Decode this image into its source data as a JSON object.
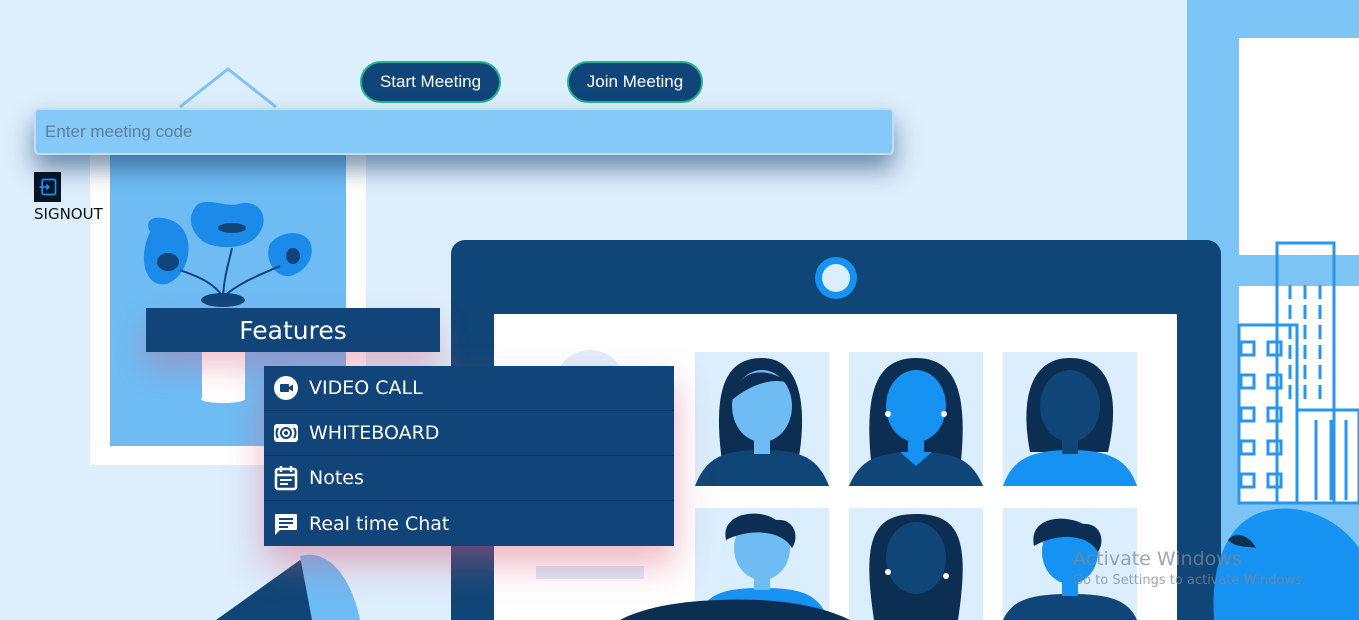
{
  "header": {
    "start_meeting_label": "Start Meeting",
    "join_meeting_label": "Join Meeting"
  },
  "meeting_code": {
    "value": "",
    "placeholder": "Enter meeting code"
  },
  "signout": {
    "label": "SIGNOUT",
    "icon": "signout-icon"
  },
  "features": {
    "title": "Features",
    "items": [
      {
        "label": "VIDEO CALL",
        "icon": "video-call-icon"
      },
      {
        "label": "WHITEBOARD",
        "icon": "whiteboard-icon"
      },
      {
        "label": "Notes",
        "icon": "notes-icon"
      },
      {
        "label": "Real time Chat",
        "icon": "chat-icon"
      }
    ]
  },
  "watermark": {
    "title": "Activate Windows",
    "subtitle": "Go to Settings to activate Windows."
  },
  "colors": {
    "primary_dark": "#11457a",
    "button_border": "#1fb58c",
    "input_bg": "#84c9f7",
    "page_bg": "#ddeefd",
    "accent_blue": "#1592f2"
  }
}
